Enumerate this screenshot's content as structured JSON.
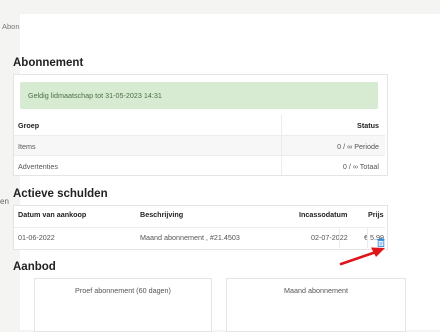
{
  "breadcrumb": "Abonnement",
  "sidebar_fragment": "en",
  "subscription": {
    "heading": "Abonnement",
    "alert": "Geldig lidmaatschap tot 31-05-2023 14:31",
    "columns": {
      "group": "Groep",
      "status": "Status"
    },
    "rows": [
      {
        "label": "Items",
        "status": "0 / ∞ Periode"
      },
      {
        "label": "Advertenties",
        "status": "0 / ∞ Totaal"
      }
    ]
  },
  "debts": {
    "heading": "Actieve schulden",
    "columns": {
      "date": "Datum van aankoop",
      "description": "Beschrijving",
      "collection_date": "Incassodatum",
      "price": "Prijs"
    },
    "rows": [
      {
        "date": "01-06-2022",
        "description": "Maand abonnement , #21.4503",
        "collection_date": "02-07-2022",
        "price": "€ 5.99"
      }
    ]
  },
  "offer": {
    "heading": "Aanbod",
    "plans": [
      {
        "label": "Proef abonnement (60 dagen)"
      },
      {
        "label": "Maand abonnement"
      }
    ]
  },
  "colors": {
    "alert_bg": "#d6ebd1",
    "alert_text": "#4e6e47",
    "trash_icon": "#3a8dde",
    "annotation_arrow": "#e0141b"
  },
  "icons": {
    "delete": "trash-icon",
    "annotation": "red-arrow-annotation"
  }
}
